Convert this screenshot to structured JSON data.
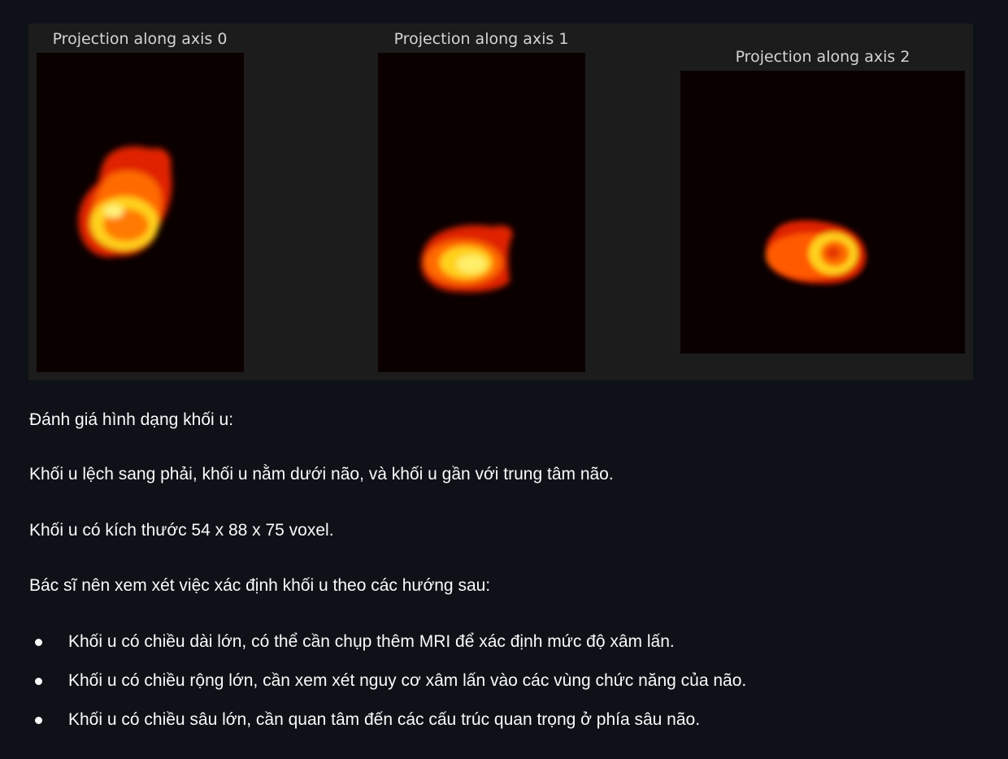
{
  "figure": {
    "panels": [
      {
        "title": "Projection along axis 0"
      },
      {
        "title": "Projection along axis 1"
      },
      {
        "title": "Projection along axis 2"
      }
    ]
  },
  "content": {
    "heading": "Đánh giá hình dạng khối u:",
    "para1": "Khối u lệch sang phải, khối u nằm dưới não, và khối u gần với trung tâm não.",
    "para2": "Khối u có kích thước 54 x 88 x 75 voxel.",
    "para3": "Bác sĩ nên xem xét việc xác định khối u theo các hướng sau:",
    "bullets": [
      "Khối u có chiều dài lớn, có thể cần chụp thêm MRI để xác định mức độ xâm lấn.",
      "Khối u có chiều rộng lớn, cần xem xét nguy cơ xâm lấn vào các vùng chức năng của não.",
      "Khối u có chiều sâu lớn, cần quan tâm đến các cấu trúc quan trọng ở phía sâu não."
    ]
  },
  "colors": {
    "app_background": "#0e1117",
    "figure_background": "#1c1c1c",
    "image_background": "#0a0000",
    "colormap": "hot"
  }
}
